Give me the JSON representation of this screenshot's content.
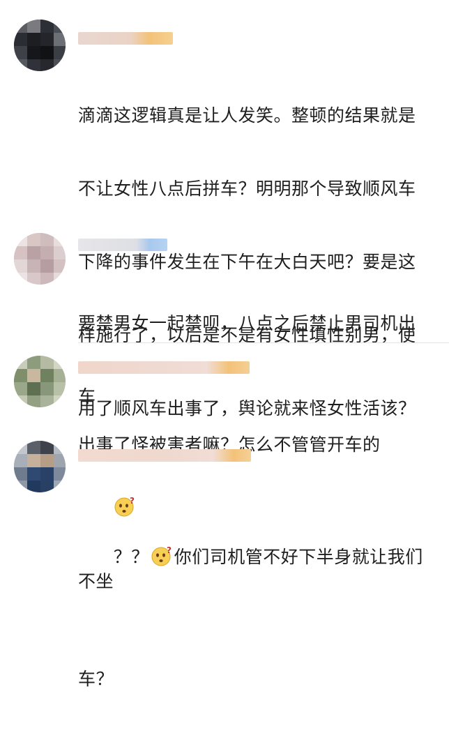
{
  "comments": [
    {
      "avatar_icon": "blurred-avatar-dark",
      "username_blurred": true,
      "text_lines": [
        "滴滴这逻辑真是让人发笑。整顿的结果就是",
        "不让女性八点后拼车？明明那个导致顺风车",
        "下降的事件发生在下午在大白天吧？要是这",
        "样施行了，以后是不是有女性填性别男，使",
        "用了顺风车出事了，舆论就来怪女性活该？"
      ],
      "trailing_emoji": "confused-face-icon"
    },
    {
      "avatar_icon": "blurred-avatar-pink",
      "username_blurred": true,
      "text_lines": [
        "要禁男女一起禁呗，八点之后禁止男司机出",
        "车"
      ]
    },
    {
      "avatar_icon": "blurred-avatar-green",
      "username_blurred": true,
      "text_lines": [
        "出事了怪被害者嘛？怎么不管管开车的"
      ]
    },
    {
      "avatar_icon": "blurred-avatar-blue",
      "username_blurred": true,
      "prefix": "？？",
      "inline_emoji": "confused-face-icon",
      "text_lines": [
        "你们司机管不好下半身就让我们不坐",
        "车？"
      ]
    }
  ],
  "colors": {
    "text": "#1e1e1e",
    "divider": "#e5e5e5",
    "username_blur_orange": "#f3c27a",
    "username_blur_blue": "#a8c8ee"
  }
}
